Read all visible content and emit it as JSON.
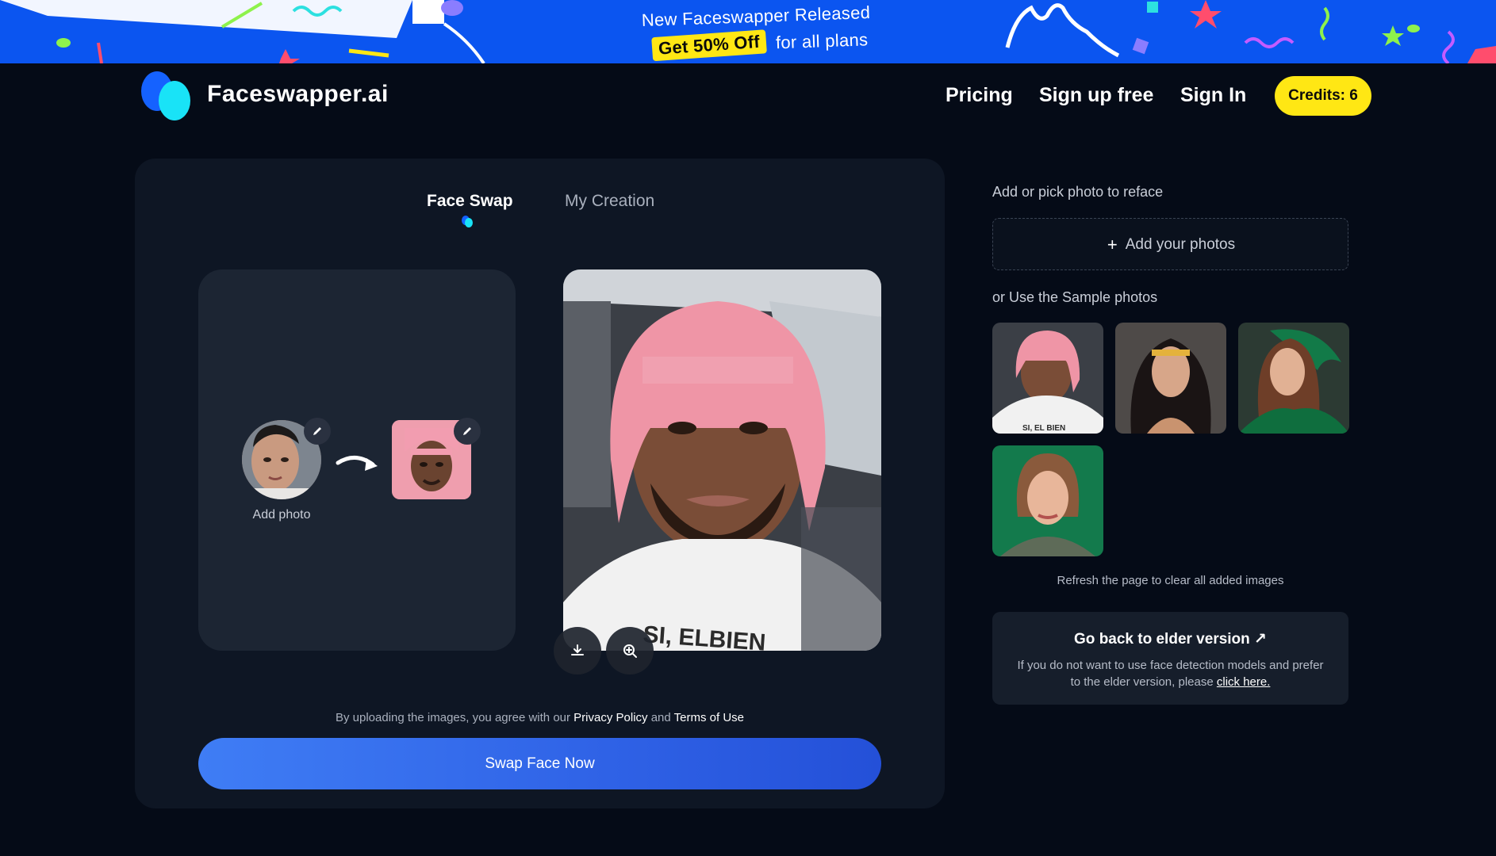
{
  "banner": {
    "line1": "New Faceswapper Released",
    "chip": "Get 50% Off",
    "line2_rest": "for all plans"
  },
  "header": {
    "brand": "Faceswapper.ai",
    "nav": {
      "pricing": "Pricing",
      "signup": "Sign up free",
      "signin": "Sign In",
      "credits": "Credits: 6"
    }
  },
  "tabs": {
    "face_swap": "Face Swap",
    "my_creation": "My Creation"
  },
  "source": {
    "add_photo_label": "Add photo"
  },
  "footer": {
    "agree_prefix": "By uploading the images, you agree with our",
    "privacy": "Privacy Policy",
    "and": "and",
    "terms": "Terms of Use",
    "swap_button": "Swap Face Now"
  },
  "right": {
    "title": "Add or pick photo to reface",
    "add_photos": "Add your photos",
    "sample_title": "or Use the Sample photos",
    "refresh_note": "Refresh the page to clear all added images",
    "elder": {
      "title": "Go back to elder version ↗",
      "desc_line1": "If you do not want to use face detection models and prefer",
      "desc_line2_prefix": "to the elder version, please",
      "desc_link": "click here."
    }
  },
  "colors": {
    "banner": "#0b55f0",
    "accent_yellow": "#ffe714",
    "page_bg": "#050b17",
    "panel_bg": "#0e1624"
  }
}
